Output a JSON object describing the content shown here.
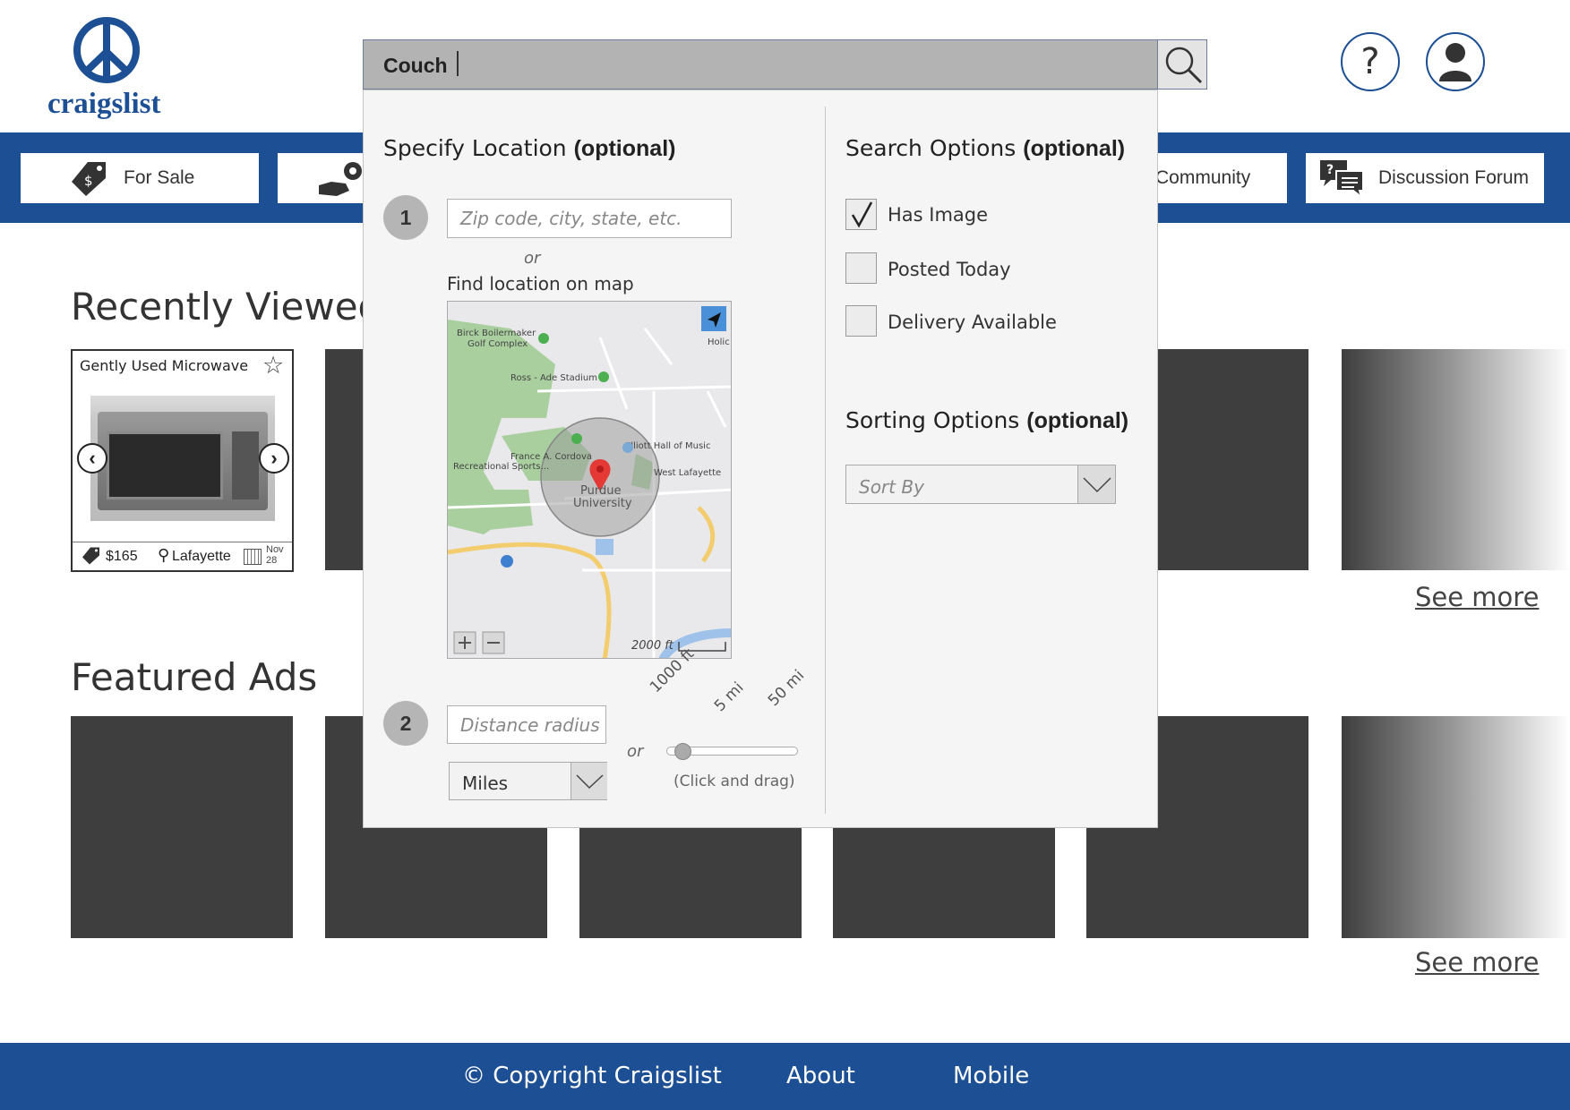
{
  "header": {
    "logo_text": "craigslist",
    "search_value": "Couch",
    "help_label": "?"
  },
  "nav": {
    "items": [
      {
        "label": "For Sale",
        "icon": "price-tag-icon"
      },
      {
        "label": "",
        "icon": "hand-gear-icon"
      },
      {
        "label": "Community",
        "icon": "people-icon"
      },
      {
        "label": "Discussion Forum",
        "icon": "chat-bubbles-icon"
      }
    ]
  },
  "recent": {
    "title": "Recently Viewed",
    "see_more": "See more",
    "card": {
      "title": "Gently Used Microwave",
      "price": "$165",
      "location": "Lafayette",
      "date_month": "Nov",
      "date_day": "28"
    }
  },
  "featured": {
    "title": "Featured Ads",
    "see_more": "See more"
  },
  "footer": {
    "copyright": "© Copyright Craigslist",
    "about": "About",
    "mobile": "Mobile"
  },
  "search_panel": {
    "location_heading": "Specify Location",
    "optional": "(optional)",
    "step1": "1",
    "step2": "2",
    "zip_placeholder": "Zip code, city, state, etc.",
    "or": "or",
    "find_on_map": "Find location on map",
    "map": {
      "labels": [
        "Birck Boilermaker Golf Complex",
        "Ross - Ade Stadium",
        "Elliott Hall of Music",
        "France A. Cordova Recreational Sports...",
        "West Lafayette",
        "Purdue University",
        "Holic"
      ],
      "scale": "2000 ft"
    },
    "distance_placeholder": "Distance radius",
    "unit_value": "Miles",
    "slider": {
      "ticks": [
        "1000 ft",
        "5 mi",
        "50 mi"
      ],
      "hint": "(Click and drag)",
      "value": 0
    },
    "search_options_heading": "Search Options",
    "checkboxes": [
      {
        "label": "Has Image",
        "checked": true
      },
      {
        "label": "Posted Today",
        "checked": false
      },
      {
        "label": "Delivery Available",
        "checked": false
      }
    ],
    "sorting_heading": "Sorting Options",
    "sort_placeholder": "Sort By"
  }
}
